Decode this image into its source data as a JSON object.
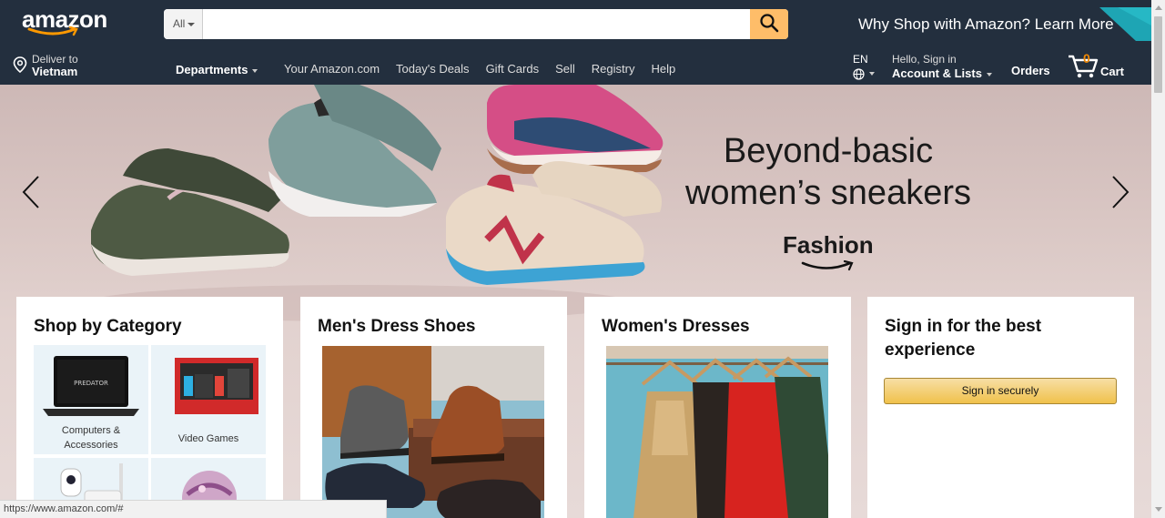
{
  "header": {
    "logo_text": "amazon",
    "search": {
      "category": "All",
      "placeholder": "",
      "value": ""
    },
    "promo": "Why Shop with Amazon? Learn More",
    "deliver": {
      "line1": "Deliver to",
      "line2": "Vietnam"
    },
    "departments": "Departments",
    "nav_links": [
      "Your Amazon.com",
      "Today's Deals",
      "Gift Cards",
      "Sell",
      "Registry",
      "Help"
    ],
    "language": "EN",
    "account": {
      "line1": "Hello, Sign in",
      "line2": "Account & Lists"
    },
    "orders": "Orders",
    "cart": {
      "count": "0",
      "label": "Cart"
    }
  },
  "hero": {
    "headline_line1": "Beyond-basic",
    "headline_line2": "women’s sneakers",
    "sub": "Fashion"
  },
  "cards": {
    "shop_by_category": {
      "title": "Shop by Category",
      "tiles": [
        {
          "label_line1": "Computers &",
          "label_line2": "Accessories"
        },
        {
          "label_line1": "Video Games",
          "label_line2": ""
        }
      ]
    },
    "mens_shoes": {
      "title": "Men's Dress Shoes"
    },
    "womens_dresses": {
      "title": "Women's Dresses"
    },
    "signin": {
      "title_line1": "Sign in for the best",
      "title_line2": "experience",
      "button": "Sign in securely"
    }
  },
  "status_bar": {
    "url": "https://www.amazon.com/#"
  },
  "colors": {
    "nav_bg": "#232f3e",
    "search_button": "#febd69",
    "cart_count": "#f08804",
    "signin_button": "#f0c14b"
  },
  "icons": [
    "search-icon",
    "location-pin-icon",
    "globe-icon",
    "cart-icon",
    "chevron-left-icon",
    "chevron-right-icon"
  ]
}
